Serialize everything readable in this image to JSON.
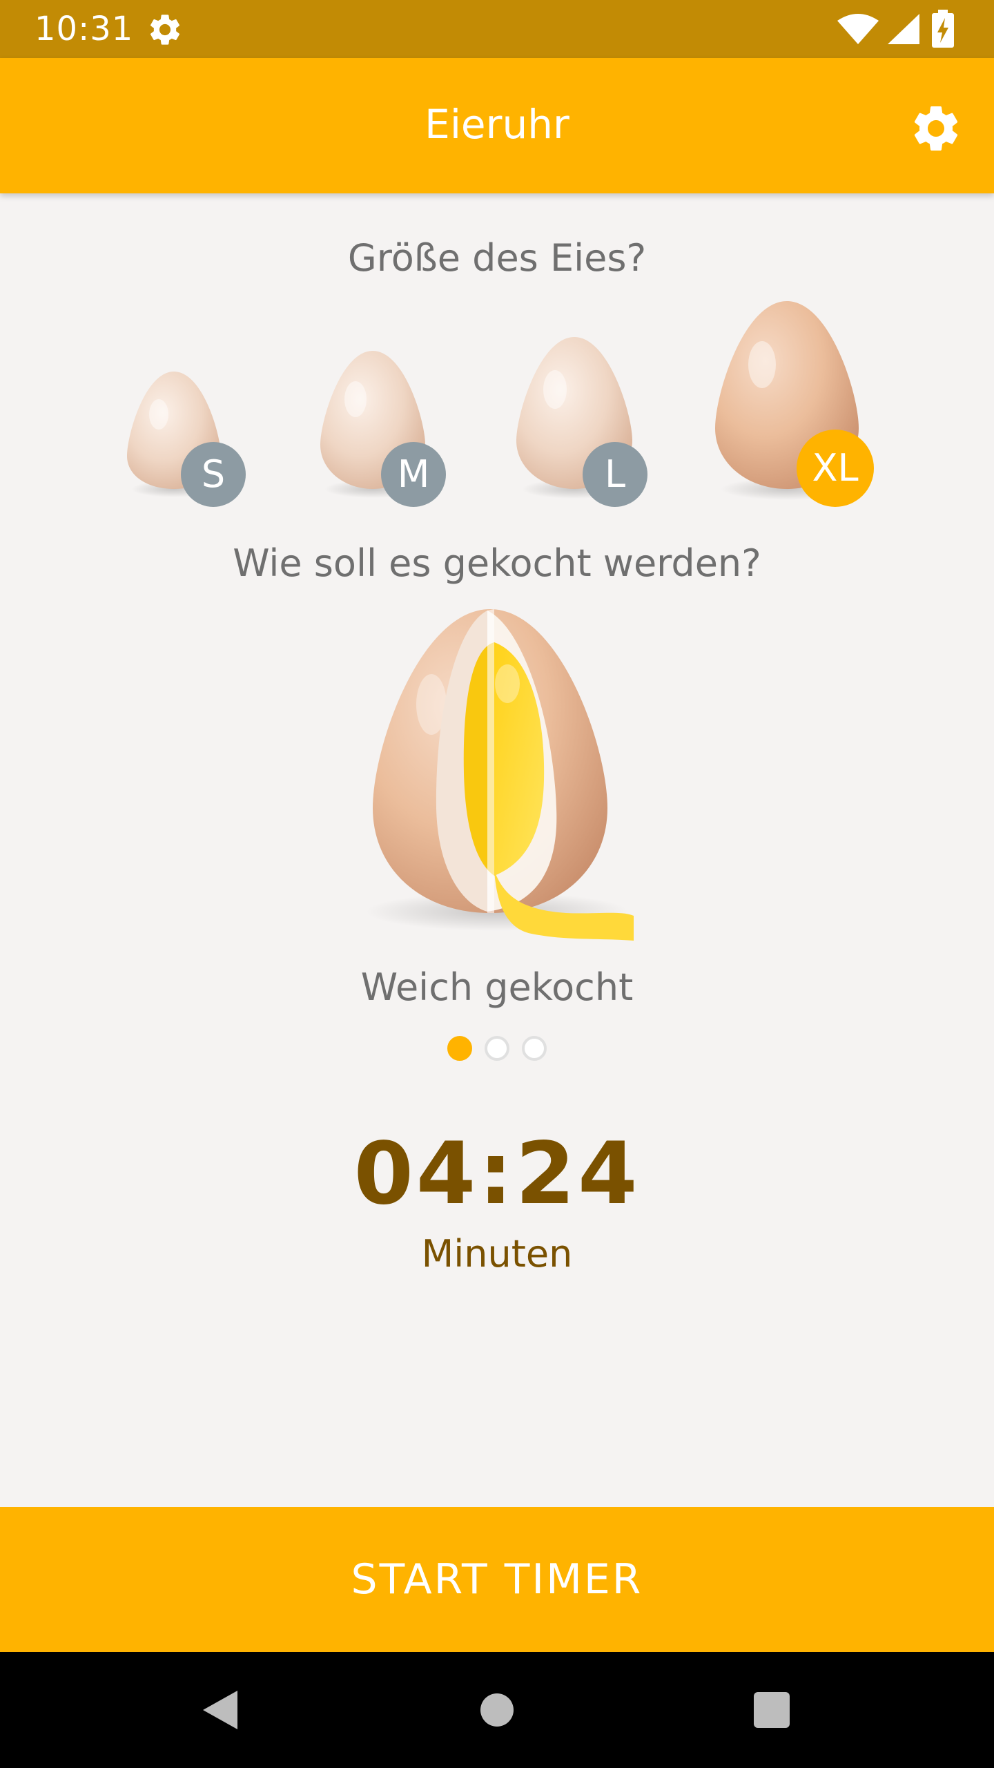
{
  "status_bar": {
    "time": "10:31",
    "icons": [
      "gear-icon",
      "wifi-icon",
      "signal-icon",
      "battery-charging-icon"
    ]
  },
  "app_bar": {
    "title": "Eieruhr",
    "settings_icon": "gear-icon"
  },
  "size_section": {
    "heading": "Größe des Eies?",
    "options": [
      {
        "label": "S",
        "selected": false
      },
      {
        "label": "M",
        "selected": false
      },
      {
        "label": "L",
        "selected": false
      },
      {
        "label": "XL",
        "selected": true
      }
    ]
  },
  "cook_section": {
    "heading": "Wie soll es gekocht werden?",
    "current_label": "Weich gekocht",
    "page_count": 3,
    "current_page": 1
  },
  "timer": {
    "value": "04:24",
    "unit": "Minuten"
  },
  "start_button": {
    "label": "START TIMER"
  },
  "nav_bar": {
    "icons": [
      "back-icon",
      "home-icon",
      "recents-icon"
    ]
  },
  "colors": {
    "status_bar": "#c28b05",
    "accent": "#ffb300",
    "badge_inactive": "#8d9ba3",
    "timer_text": "#7a5100",
    "heading_text": "#6f6f6f",
    "background": "#f5f3f2"
  }
}
